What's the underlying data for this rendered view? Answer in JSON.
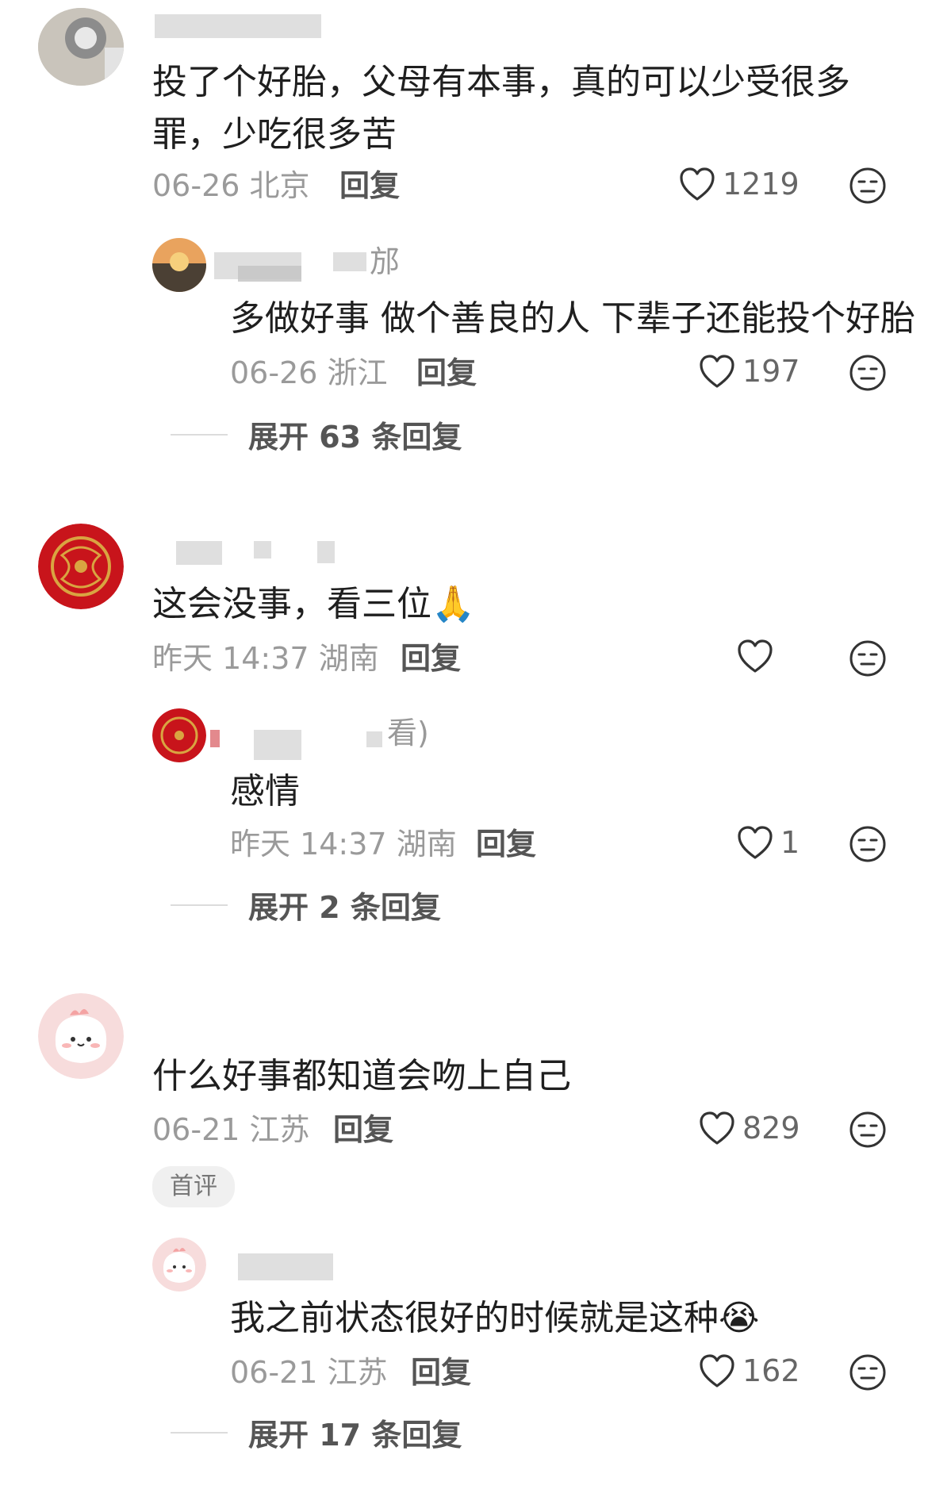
{
  "comments": [
    {
      "author": "",
      "region_hint": "",
      "text_line1": "投了个好胎，父母有本事，真的可以少受很多",
      "text_line2": "罪，少吃很多苦",
      "date": "06-26",
      "location": "北京",
      "reply_label": "回复",
      "likes": "1219",
      "reply": {
        "author_suffix": "邡",
        "text": "多做好事 做个善良的人 下辈子还能投个好胎",
        "date": "06-26",
        "location": "浙江",
        "reply_label": "回复",
        "likes": "197"
      },
      "expand": "展开 63 条回复"
    },
    {
      "text": "这会没事，看三位",
      "emoji": "🙏",
      "date": "昨天 14:37",
      "location": "湖南",
      "reply_label": "回复",
      "likes": "",
      "reply": {
        "author_suffix": "看)",
        "text": "感情",
        "date": "昨天 14:37",
        "location": "湖南",
        "reply_label": "回复",
        "likes": "1"
      },
      "expand": "展开 2 条回复"
    },
    {
      "text": "什么好事都知道会吻上自己",
      "date": "06-21",
      "location": "江苏",
      "reply_label": "回复",
      "likes": "829",
      "badge": "首评",
      "reply": {
        "text": "我之前状态很好的时候就是这种",
        "emoji": "😭",
        "date": "06-21",
        "location": "江苏",
        "reply_label": "回复",
        "likes": "162"
      },
      "expand": "展开 17 条回复"
    }
  ],
  "icons": {
    "like": "heart-outline-icon",
    "dislike": "neutral-face-icon"
  },
  "colors": {
    "text": "#1f1f1f",
    "meta": "#9a9a9a",
    "reply": "#555555",
    "avatar_red": "#c8141b",
    "avatar_gold": "#d9a441",
    "avatar_pink": "#f7dcdc"
  }
}
